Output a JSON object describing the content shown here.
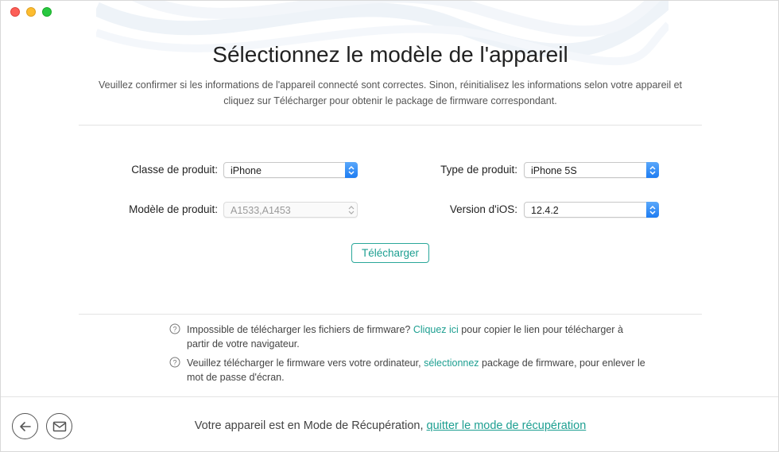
{
  "page": {
    "title": "Sélectionnez le modèle de l'appareil",
    "subtitle": "Veuillez confirmer si les informations de l'appareil connecté sont correctes. Sinon, réinitialisez les informations selon votre appareil et cliquez sur Télécharger pour obtenir le package de firmware correspondant."
  },
  "form": {
    "product_class": {
      "label": "Classe de produit:",
      "value": "iPhone"
    },
    "product_type": {
      "label": "Type de produit:",
      "value": "iPhone 5S"
    },
    "product_model": {
      "label": "Modèle de produit:",
      "value": "A1533,A1453"
    },
    "ios_version": {
      "label": "Version d'iOS:",
      "value": "12.4.2"
    },
    "download_label": "Télécharger"
  },
  "help": [
    {
      "before": "Impossible de télécharger les fichiers de firmware? ",
      "link": "Cliquez ici",
      "after": " pour copier le lien pour télécharger à partir de votre navigateur."
    },
    {
      "before": "Veuillez télécharger le firmware vers votre ordinateur, ",
      "link": "sélectionnez",
      "after": " package de firmware, pour enlever le mot de passe d'écran."
    }
  ],
  "footer": {
    "text": "Votre appareil est en Mode de Récupération, ",
    "link": "quitter le mode de récupération"
  },
  "colors": {
    "accent": "#1d9f91",
    "select_blue": "#1d7cf2"
  },
  "icons": {
    "back": "back-arrow-icon",
    "mail": "mail-icon",
    "help": "question-circle-icon"
  }
}
